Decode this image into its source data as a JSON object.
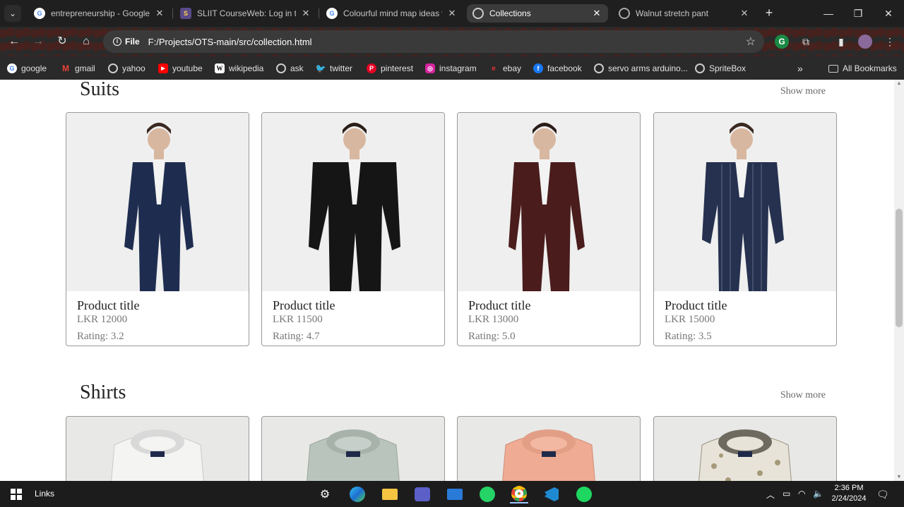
{
  "browser": {
    "tabs": [
      {
        "title": "entrepreneurship - Google S",
        "icon": "google-icon",
        "active": false
      },
      {
        "title": "SLIIT CourseWeb: Log in to t",
        "icon": "sliit-icon",
        "active": false
      },
      {
        "title": "Colourful mind map ideas w",
        "icon": "google-icon",
        "active": false
      },
      {
        "title": "Collections",
        "icon": "globe-icon",
        "active": true
      },
      {
        "title": "Walnut stretch pant",
        "icon": "globe-icon",
        "active": false
      }
    ],
    "site_chip": "File",
    "url": "F:/Projects/OTS-main/src/collection.html",
    "bookmarks": [
      {
        "label": "google",
        "icon": "google-icon"
      },
      {
        "label": "gmail",
        "icon": "gmail-icon"
      },
      {
        "label": "yahoo",
        "icon": "globe-icon"
      },
      {
        "label": "youtube",
        "icon": "youtube-icon"
      },
      {
        "label": "wikipedia",
        "icon": "wikipedia-icon"
      },
      {
        "label": "ask",
        "icon": "globe-icon"
      },
      {
        "label": "twitter",
        "icon": "twitter-icon"
      },
      {
        "label": "pinterest",
        "icon": "pinterest-icon"
      },
      {
        "label": "instagram",
        "icon": "instagram-icon"
      },
      {
        "label": "ebay",
        "icon": "ebay-icon"
      },
      {
        "label": "facebook",
        "icon": "facebook-icon"
      },
      {
        "label": "servo arms arduino...",
        "icon": "globe-icon"
      },
      {
        "label": "SpriteBox",
        "icon": "globe-icon"
      }
    ],
    "all_bookmarks": "All Bookmarks"
  },
  "page": {
    "sections": [
      {
        "title": "Suits",
        "show_more": "Show more",
        "products": [
          {
            "title": "Product title",
            "price": "LKR 12000",
            "rating": "Rating: 3.2",
            "suit_color": "#1e2d4f"
          },
          {
            "title": "Product title",
            "price": "LKR 11500",
            "rating": "Rating: 4.7",
            "suit_color": "#151515"
          },
          {
            "title": "Product title",
            "price": "LKR 13000",
            "rating": "Rating: 5.0",
            "suit_color": "#4a1c1c"
          },
          {
            "title": "Product title",
            "price": "LKR 15000",
            "rating": "Rating: 3.5",
            "suit_color": "#25314f"
          }
        ]
      },
      {
        "title": "Shirts",
        "show_more": "Show more",
        "products": [
          {
            "shirt_color": "#f4f4f2"
          },
          {
            "shirt_color": "#b9c4bd"
          },
          {
            "shirt_color": "#efab93"
          },
          {
            "shirt_color": "#e7e3d8"
          }
        ]
      }
    ]
  },
  "taskbar": {
    "label": "Links",
    "time": "2:36 PM",
    "date": "2/24/2024"
  }
}
